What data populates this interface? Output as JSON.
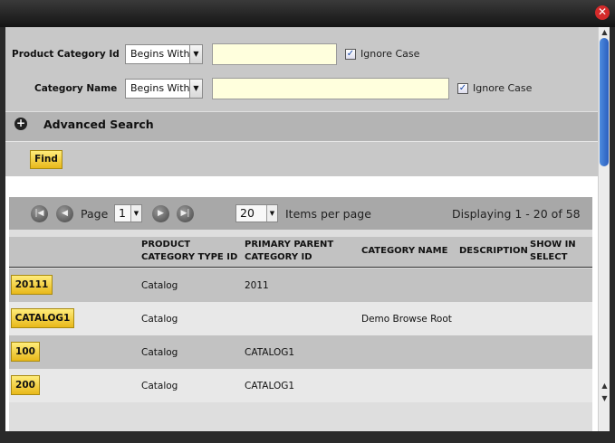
{
  "window": {
    "close_symbol": "✕"
  },
  "search": {
    "fields": [
      {
        "label": "Product Category Id",
        "operator": "Begins With",
        "value": "",
        "ignore_case_label": "Ignore Case",
        "ignore_case_checked": true
      },
      {
        "label": "Category Name",
        "operator": "Begins With",
        "value": "",
        "ignore_case_label": "Ignore Case",
        "ignore_case_checked": true
      }
    ],
    "advanced_label": "Advanced Search",
    "find_label": "Find"
  },
  "pager": {
    "page_label": "Page",
    "page_value": "1",
    "items_value": "20",
    "items_label": "Items per page",
    "displaying": "Displaying 1 - 20 of 58"
  },
  "table": {
    "headers": [
      "PRODUCT CATEGORY TYPE ID",
      "PRIMARY PARENT CATEGORY ID",
      "CATEGORY NAME",
      "DESCRIPTION",
      "SHOW IN SELECT"
    ],
    "header_lines": [
      [
        "PRODUCT",
        "CATEGORY TYPE ID"
      ],
      [
        "PRIMARY PARENT",
        "CATEGORY ID"
      ],
      [
        "CATEGORY NAME"
      ],
      [
        "DESCRIPTION"
      ],
      [
        "SHOW IN",
        "SELECT"
      ]
    ],
    "rows": [
      {
        "id": "20111",
        "type": "Catalog",
        "parent": "2011",
        "name": "",
        "description": "",
        "show": ""
      },
      {
        "id": "CATALOG1",
        "type": "Catalog",
        "parent": "",
        "name": "Demo Browse Root",
        "description": "",
        "show": ""
      },
      {
        "id": "100",
        "type": "Catalog",
        "parent": "CATALOG1",
        "name": "",
        "description": "",
        "show": ""
      },
      {
        "id": "200",
        "type": "Catalog",
        "parent": "CATALOG1",
        "name": "",
        "description": "",
        "show": ""
      }
    ]
  },
  "icons": {
    "plus": "plus-circle-icon",
    "first": "first-page-icon",
    "prev": "previous-page-icon",
    "next": "next-page-icon",
    "last": "last-page-icon",
    "close": "close-icon"
  }
}
